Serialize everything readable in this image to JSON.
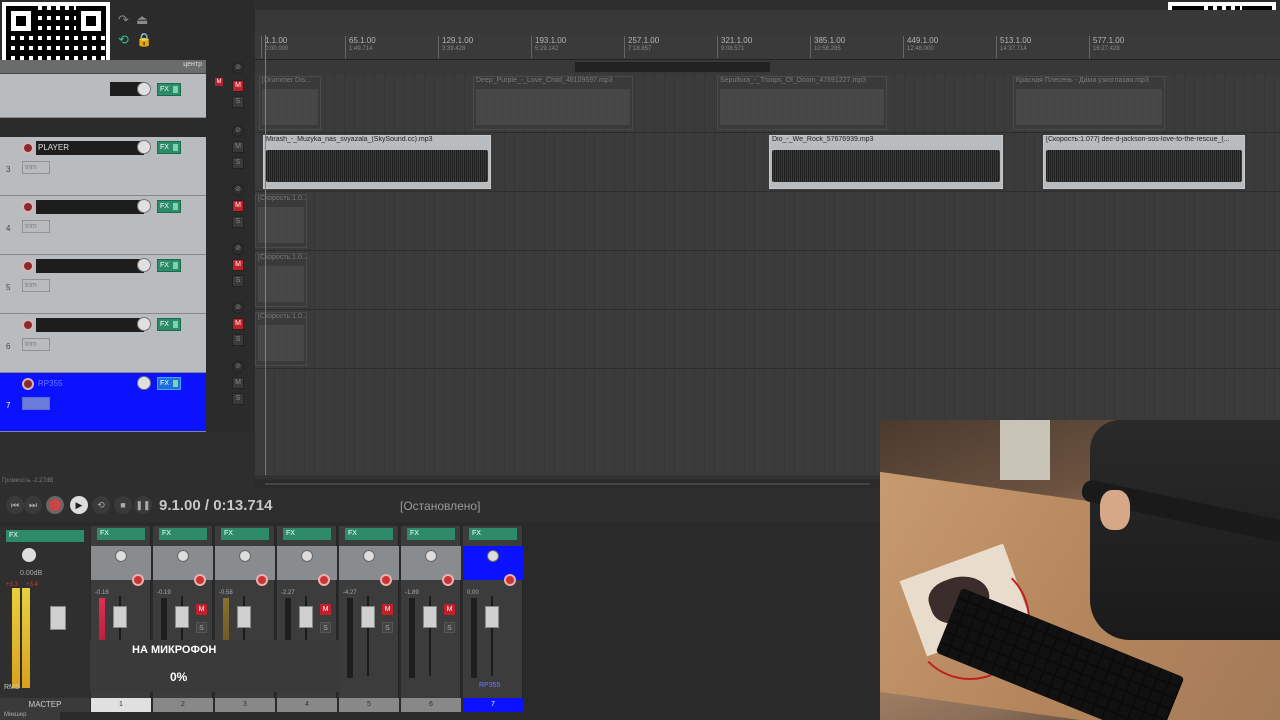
{
  "transport": {
    "position": "9.1.00 / 0:13.714",
    "state": "[Остановлено]"
  },
  "status_small": "Громкость -2.27dB",
  "tcp": {
    "pan_header": "центр",
    "tracks": [
      {
        "num": "",
        "name": "",
        "trim": ""
      },
      {
        "num": "3",
        "name": "PLAYER",
        "trim": "trim"
      },
      {
        "num": "4",
        "name": "",
        "trim": "trim"
      },
      {
        "num": "5",
        "name": "",
        "trim": "trim"
      },
      {
        "num": "6",
        "name": "",
        "trim": "trim"
      },
      {
        "num": "7",
        "name": "RP355",
        "trim": "trim"
      }
    ],
    "fx_label": "FX"
  },
  "ruler": [
    {
      "bar": "1.1.00",
      "time": "0:00.000"
    },
    {
      "bar": "65.1.00",
      "time": "1:49.714"
    },
    {
      "bar": "129.1.00",
      "time": "3:39.428"
    },
    {
      "bar": "193.1.00",
      "time": "5:29.142"
    },
    {
      "bar": "257.1.00",
      "time": "7:18.857"
    },
    {
      "bar": "321.1.00",
      "time": "9:08.571"
    },
    {
      "bar": "385.1.00",
      "time": "10:58.285"
    },
    {
      "bar": "449.1.00",
      "time": "12:48.000"
    },
    {
      "bar": "513.1.00",
      "time": "14:37.714"
    },
    {
      "bar": "577.1.00",
      "time": "16:27.428"
    }
  ],
  "items": {
    "lane1": [
      "[Drummer Dis...",
      "Deep_Purple_-_Love_Child_48109597.mp3",
      "Sepultura_-_Troops_Of_Doom_47891227.mp3",
      "Красная Плесень - Дама узкоглазая.mp3"
    ],
    "lane2": [
      "Mirash_-_Muzyka_nas_svyazala_(SkySound.cc).mp3",
      "Dio_-_We_Rock_57676939.mp3",
      "[Скорость:1.077] dee-d-jackson-sos-love-to-the-rescue_(..."
    ],
    "lane3": [
      "[Скорость:1.0..."
    ],
    "lane4": [
      "[Скорость:1.0..."
    ],
    "lane5": [
      "[Скорость:1.0..."
    ]
  },
  "mixer": {
    "master_label": "МАСТЕР",
    "master_db": "0.00dB",
    "master_peak_l": "+3.3",
    "master_peak_r": "+3.4",
    "rms_label": "RMS",
    "strips": [
      {
        "label": "1",
        "db": "-0.16",
        "peak": "+8.8"
      },
      {
        "label": "2",
        "db": "-0.19",
        "peak": ""
      },
      {
        "label": "3",
        "db": "-0.58",
        "peak": "+3.6"
      },
      {
        "label": "4",
        "db": "-2.27",
        "peak": ""
      },
      {
        "label": "5",
        "db": "-4.27",
        "peak": ""
      },
      {
        "label": "6",
        "db": "-1.89",
        "peak": ""
      },
      {
        "label": "7",
        "db": "0.00",
        "peak": "-52.3",
        "name": "RP355"
      }
    ],
    "route_label": "Route",
    "in_label": "in"
  },
  "overlay": {
    "mic_label": "НА МИКРОФОН",
    "percent": "0%"
  },
  "bottom_tab": "Микшер",
  "colors": {
    "selected_blue": "#0a12ff",
    "mute_red": "#c0202a",
    "fx_green": "#2e8b6a"
  }
}
